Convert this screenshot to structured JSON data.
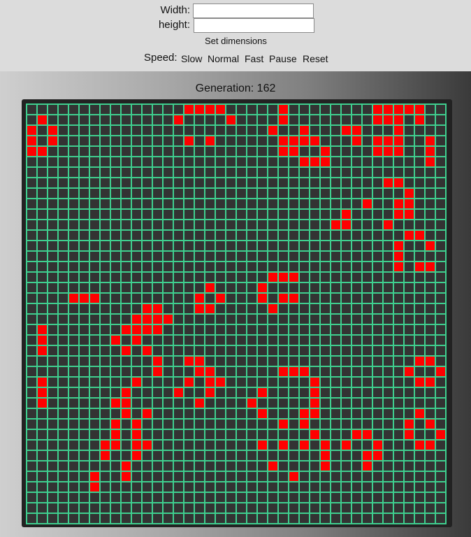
{
  "form": {
    "width_label": "Width:",
    "width_value": "",
    "height_label": "height:",
    "height_value": "",
    "set_dimensions_label": "Set dimensions"
  },
  "speed": {
    "label": "Speed:",
    "slow": "Slow",
    "normal": "Normal",
    "fast": "Fast",
    "pause": "Pause",
    "reset": "Reset"
  },
  "status": {
    "generation_text": "Generation: 162",
    "generation": 162
  },
  "board": {
    "cols": 40,
    "rows": 40,
    "colors": {
      "background": "#333333",
      "grid_line": "#3fcf8f",
      "live_cell": "#ff0000",
      "frame": "#222222"
    },
    "live_cells": [
      [
        0,
        15
      ],
      [
        0,
        16
      ],
      [
        0,
        17
      ],
      [
        0,
        18
      ],
      [
        0,
        24
      ],
      [
        0,
        33
      ],
      [
        0,
        34
      ],
      [
        0,
        35
      ],
      [
        0,
        36
      ],
      [
        0,
        37
      ],
      [
        1,
        1
      ],
      [
        1,
        14
      ],
      [
        1,
        19
      ],
      [
        1,
        24
      ],
      [
        1,
        33
      ],
      [
        1,
        34
      ],
      [
        1,
        35
      ],
      [
        1,
        37
      ],
      [
        2,
        0
      ],
      [
        2,
        2
      ],
      [
        2,
        23
      ],
      [
        2,
        26
      ],
      [
        2,
        30
      ],
      [
        2,
        31
      ],
      [
        2,
        35
      ],
      [
        3,
        0
      ],
      [
        3,
        2
      ],
      [
        3,
        15
      ],
      [
        3,
        17
      ],
      [
        3,
        24
      ],
      [
        3,
        25
      ],
      [
        3,
        26
      ],
      [
        3,
        27
      ],
      [
        3,
        31
      ],
      [
        3,
        33
      ],
      [
        3,
        34
      ],
      [
        3,
        35
      ],
      [
        3,
        38
      ],
      [
        4,
        0
      ],
      [
        4,
        1
      ],
      [
        4,
        24
      ],
      [
        4,
        25
      ],
      [
        4,
        28
      ],
      [
        4,
        33
      ],
      [
        4,
        34
      ],
      [
        4,
        35
      ],
      [
        4,
        38
      ],
      [
        5,
        26
      ],
      [
        5,
        27
      ],
      [
        5,
        28
      ],
      [
        5,
        38
      ],
      [
        7,
        34
      ],
      [
        7,
        35
      ],
      [
        8,
        36
      ],
      [
        9,
        32
      ],
      [
        9,
        35
      ],
      [
        9,
        36
      ],
      [
        10,
        30
      ],
      [
        10,
        35
      ],
      [
        10,
        36
      ],
      [
        11,
        29
      ],
      [
        11,
        30
      ],
      [
        11,
        34
      ],
      [
        12,
        36
      ],
      [
        12,
        37
      ],
      [
        13,
        35
      ],
      [
        13,
        38
      ],
      [
        14,
        35
      ],
      [
        15,
        35
      ],
      [
        15,
        37
      ],
      [
        15,
        38
      ],
      [
        16,
        23
      ],
      [
        16,
        24
      ],
      [
        16,
        25
      ],
      [
        17,
        17
      ],
      [
        17,
        22
      ],
      [
        18,
        4
      ],
      [
        18,
        5
      ],
      [
        18,
        6
      ],
      [
        18,
        16
      ],
      [
        18,
        18
      ],
      [
        18,
        22
      ],
      [
        18,
        24
      ],
      [
        18,
        25
      ],
      [
        19,
        11
      ],
      [
        19,
        12
      ],
      [
        19,
        16
      ],
      [
        19,
        17
      ],
      [
        19,
        23
      ],
      [
        20,
        10
      ],
      [
        20,
        11
      ],
      [
        20,
        12
      ],
      [
        20,
        13
      ],
      [
        21,
        1
      ],
      [
        21,
        9
      ],
      [
        21,
        10
      ],
      [
        21,
        11
      ],
      [
        21,
        12
      ],
      [
        22,
        1
      ],
      [
        22,
        8
      ],
      [
        22,
        10
      ],
      [
        23,
        1
      ],
      [
        23,
        9
      ],
      [
        23,
        11
      ],
      [
        24,
        12
      ],
      [
        24,
        15
      ],
      [
        24,
        16
      ],
      [
        24,
        37
      ],
      [
        24,
        38
      ],
      [
        25,
        12
      ],
      [
        25,
        16
      ],
      [
        25,
        17
      ],
      [
        25,
        24
      ],
      [
        25,
        25
      ],
      [
        25,
        26
      ],
      [
        25,
        36
      ],
      [
        25,
        39
      ],
      [
        26,
        1
      ],
      [
        26,
        10
      ],
      [
        26,
        15
      ],
      [
        26,
        17
      ],
      [
        26,
        18
      ],
      [
        26,
        27
      ],
      [
        26,
        37
      ],
      [
        26,
        38
      ],
      [
        27,
        1
      ],
      [
        27,
        9
      ],
      [
        27,
        14
      ],
      [
        27,
        17
      ],
      [
        27,
        22
      ],
      [
        27,
        27
      ],
      [
        28,
        1
      ],
      [
        28,
        8
      ],
      [
        28,
        9
      ],
      [
        28,
        16
      ],
      [
        28,
        21
      ],
      [
        28,
        27
      ],
      [
        29,
        9
      ],
      [
        29,
        11
      ],
      [
        29,
        22
      ],
      [
        29,
        26
      ],
      [
        29,
        27
      ],
      [
        29,
        37
      ],
      [
        30,
        8
      ],
      [
        30,
        10
      ],
      [
        30,
        24
      ],
      [
        30,
        26
      ],
      [
        30,
        36
      ],
      [
        30,
        38
      ],
      [
        31,
        8
      ],
      [
        31,
        10
      ],
      [
        31,
        27
      ],
      [
        31,
        31
      ],
      [
        31,
        32
      ],
      [
        31,
        36
      ],
      [
        31,
        39
      ],
      [
        32,
        7
      ],
      [
        32,
        8
      ],
      [
        32,
        10
      ],
      [
        32,
        11
      ],
      [
        32,
        22
      ],
      [
        32,
        24
      ],
      [
        32,
        26
      ],
      [
        32,
        28
      ],
      [
        32,
        30
      ],
      [
        32,
        33
      ],
      [
        32,
        37
      ],
      [
        32,
        38
      ],
      [
        33,
        7
      ],
      [
        33,
        10
      ],
      [
        33,
        28
      ],
      [
        33,
        32
      ],
      [
        33,
        33
      ],
      [
        34,
        9
      ],
      [
        34,
        23
      ],
      [
        34,
        28
      ],
      [
        34,
        32
      ],
      [
        35,
        6
      ],
      [
        35,
        9
      ],
      [
        35,
        25
      ],
      [
        36,
        6
      ]
    ]
  }
}
